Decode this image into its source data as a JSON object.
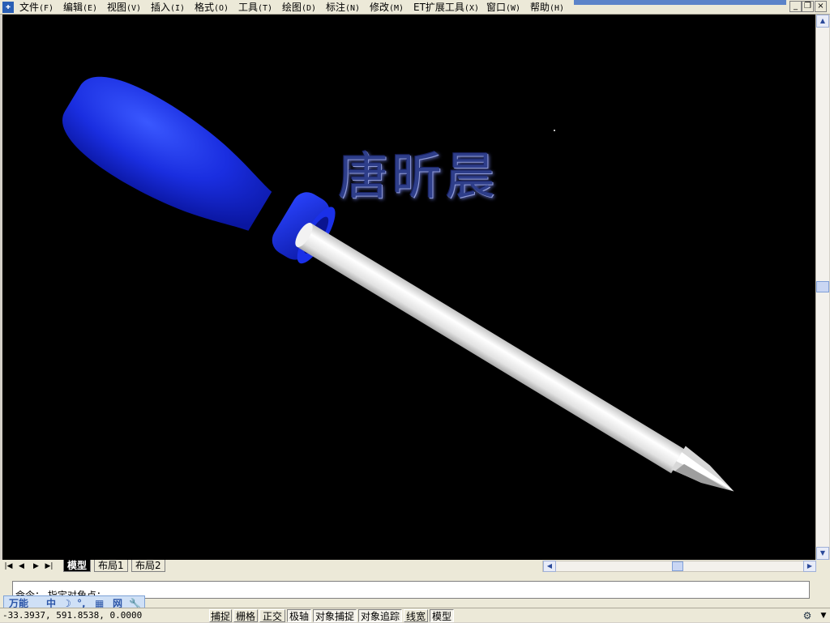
{
  "menubar": {
    "app_icon": "cad-app-icon",
    "items": [
      {
        "label": "文件",
        "acc": "(F)"
      },
      {
        "label": "编辑",
        "acc": "(E)"
      },
      {
        "label": "视图",
        "acc": "(V)"
      },
      {
        "label": "插入",
        "acc": "(I)"
      },
      {
        "label": "格式",
        "acc": "(O)"
      },
      {
        "label": "工具",
        "acc": "(T)"
      },
      {
        "label": "绘图",
        "acc": "(D)"
      },
      {
        "label": "标注",
        "acc": "(N)"
      },
      {
        "label": "修改",
        "acc": "(M)"
      },
      {
        "label": "ET扩展工具",
        "acc": "(X)"
      },
      {
        "label": "窗口",
        "acc": "(W)"
      },
      {
        "label": "帮助",
        "acc": "(H)"
      }
    ],
    "window_buttons": {
      "minimize": "_",
      "restore": "❐",
      "close": "×"
    }
  },
  "drawing": {
    "title_text": "唐昕晨",
    "handle_color": "#1a2ee0",
    "shaft_color": "#e6e6e6",
    "background": "#000000"
  },
  "tabs": {
    "nav": [
      "|◀",
      "◀",
      "▶",
      "▶|"
    ],
    "items": [
      "模型",
      "布局1",
      "布局2"
    ],
    "active": "模型"
  },
  "command": {
    "line_text": "命令： 指定对角点："
  },
  "ime": {
    "items": [
      "万能",
      "中",
      "☽",
      "°,",
      "▦",
      "网",
      "🔧"
    ]
  },
  "status": {
    "coords": "-33.3937,  591.8538,  0.0000",
    "toggles": [
      {
        "label": "捕捉",
        "on": false
      },
      {
        "label": "栅格",
        "on": false
      },
      {
        "label": "正交",
        "on": false
      },
      {
        "label": "极轴",
        "on": true
      },
      {
        "label": "对象捕捉",
        "on": true
      },
      {
        "label": "对象追踪",
        "on": true
      },
      {
        "label": "线宽",
        "on": false
      },
      {
        "label": "模型",
        "on": true
      }
    ]
  }
}
